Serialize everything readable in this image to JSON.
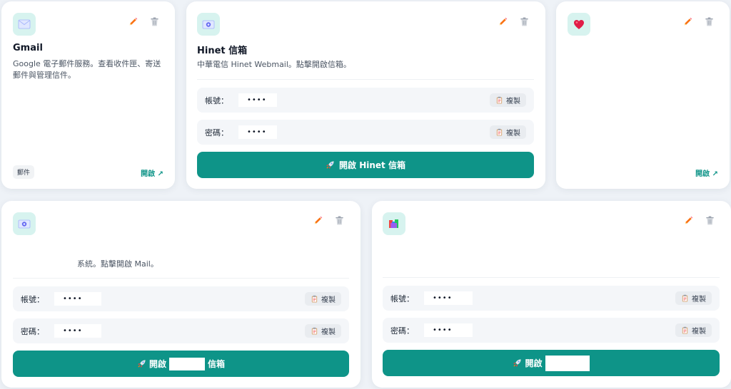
{
  "colors": {
    "accent": "#0e9488",
    "edit_icon": "#f97316",
    "delete_icon": "#9ca3af",
    "icon_bg": "#d7f3ef"
  },
  "cards": {
    "gmail": {
      "icon": "envelope-icon",
      "title": "Gmail",
      "description": "Google 電子郵件服務。查看收件匣、寄送郵件與管理信件。",
      "tag": "郵件",
      "open_link": "開啟 ↗"
    },
    "hinet": {
      "icon": "mail-at-icon",
      "title": "Hinet 信箱",
      "description": "中華電信 Hinet Webmail。點擊開啟信箱。",
      "account_label": "帳號：",
      "account_value": "••••",
      "password_label": "密碼：",
      "password_value": "••••",
      "copy_label": "複製",
      "open_button": "開啟 Hinet 信箱"
    },
    "favorite": {
      "icon": "heart-icon",
      "open_link": "開啟 ↗"
    },
    "mail2": {
      "icon": "mail-at-icon",
      "description": "系統。點擊開啟 Mail。",
      "account_label": "帳號：",
      "account_value": "••••",
      "password_label": "密碼：",
      "password_value": "••••",
      "copy_label": "複製",
      "open_button_prefix": "開啟",
      "open_button_suffix": "信箱"
    },
    "mail3": {
      "icon": "books-icon",
      "account_label": "帳號：",
      "account_value": "••••",
      "password_label": "密碼：",
      "password_value": "••••",
      "copy_label": "複製",
      "open_button_prefix": "開啟"
    }
  }
}
